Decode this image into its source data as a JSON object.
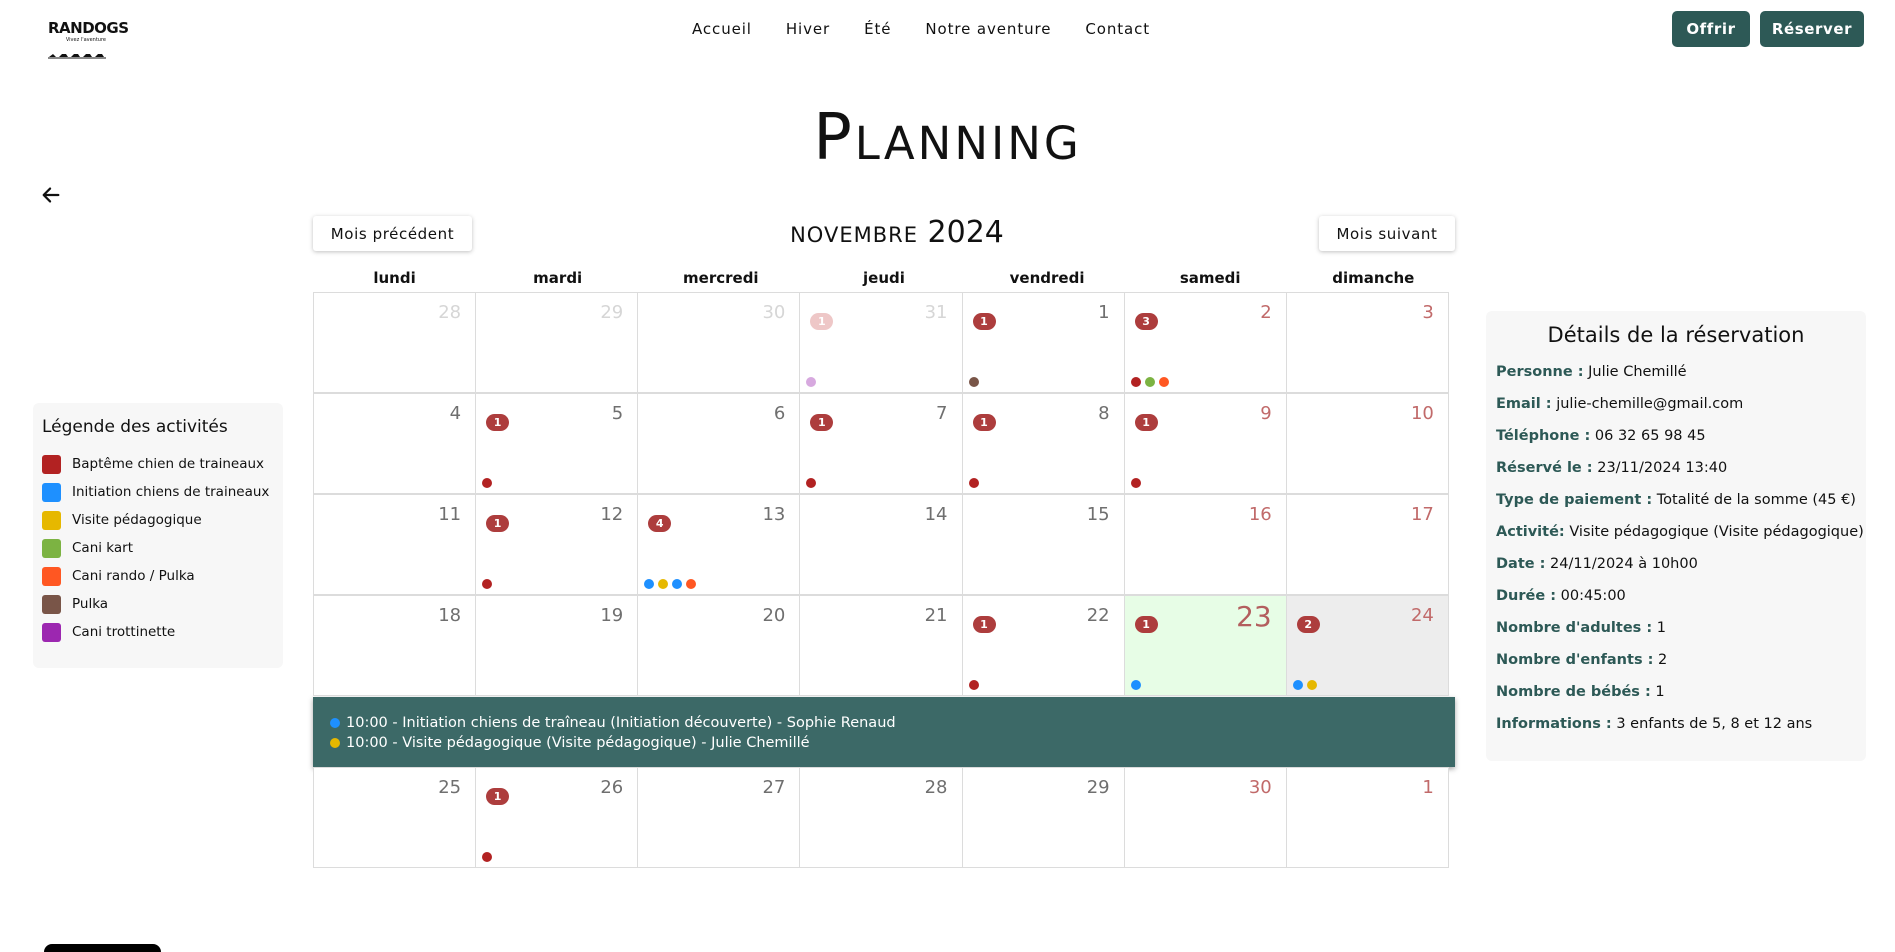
{
  "header": {
    "logo": {
      "title": "RANDOGS",
      "subtitle": "Vivez l'aventure"
    },
    "nav": [
      "Accueil",
      "Hiver",
      "Été",
      "Notre aventure",
      "Contact"
    ],
    "buttons": {
      "offrir": "Offrir",
      "reserver": "Réserver"
    },
    "accent_color": "#2d5956"
  },
  "page_title": "Planning",
  "legend": {
    "title": "Légende des activités",
    "items": [
      {
        "label": "Baptême chien de traineaux",
        "color": "#b22222"
      },
      {
        "label": "Initiation chiens de traineaux",
        "color": "#1e90ff"
      },
      {
        "label": "Visite pédagogique",
        "color": "#e6b800"
      },
      {
        "label": "Cani kart",
        "color": "#7cb342"
      },
      {
        "label": "Cani rando / Pulka",
        "color": "#ff5722"
      },
      {
        "label": "Pulka",
        "color": "#795548"
      },
      {
        "label": "Cani trottinette",
        "color": "#9c27b0"
      }
    ]
  },
  "calendar": {
    "prev_label": "Mois précédent",
    "next_label": "Mois suivant",
    "month": "novembre",
    "year": "2024",
    "weekdays": [
      "lundi",
      "mardi",
      "mercredi",
      "jeudi",
      "vendredi",
      "samedi",
      "dimanche"
    ],
    "weeks": [
      [
        {
          "day": "28",
          "other": true
        },
        {
          "day": "29",
          "other": true
        },
        {
          "day": "30",
          "other": true
        },
        {
          "day": "31",
          "other": true,
          "count": "1",
          "dots": [
            "#9c27b0"
          ]
        },
        {
          "day": "1",
          "count": "1",
          "dots": [
            "#795548"
          ]
        },
        {
          "day": "2",
          "weekend": true,
          "count": "3",
          "dots": [
            "#b22222",
            "#7cb342",
            "#ff5722"
          ]
        },
        {
          "day": "3",
          "weekend": true
        }
      ],
      [
        {
          "day": "4"
        },
        {
          "day": "5",
          "count": "1",
          "dots": [
            "#b22222"
          ]
        },
        {
          "day": "6"
        },
        {
          "day": "7",
          "count": "1",
          "dots": [
            "#b22222"
          ]
        },
        {
          "day": "8",
          "count": "1",
          "dots": [
            "#b22222"
          ]
        },
        {
          "day": "9",
          "weekend": true,
          "count": "1",
          "dots": [
            "#b22222"
          ]
        },
        {
          "day": "10",
          "weekend": true
        }
      ],
      [
        {
          "day": "11"
        },
        {
          "day": "12",
          "count": "1",
          "dots": [
            "#b22222"
          ]
        },
        {
          "day": "13",
          "count": "4",
          "dots": [
            "#1e90ff",
            "#e6b800",
            "#1e90ff",
            "#ff5722"
          ]
        },
        {
          "day": "14"
        },
        {
          "day": "15"
        },
        {
          "day": "16",
          "weekend": true
        },
        {
          "day": "17",
          "weekend": true
        }
      ],
      [
        {
          "day": "18"
        },
        {
          "day": "19"
        },
        {
          "day": "20"
        },
        {
          "day": "21"
        },
        {
          "day": "22",
          "count": "1",
          "dots": [
            "#b22222"
          ]
        },
        {
          "day": "23",
          "weekend": true,
          "today": true,
          "count": "1",
          "dots": [
            "#1e90ff"
          ]
        },
        {
          "day": "24",
          "weekend": true,
          "selected": true,
          "count": "2",
          "dots": [
            "#1e90ff",
            "#e6b800"
          ]
        }
      ],
      [
        {
          "day": "25"
        },
        {
          "day": "26",
          "count": "1",
          "dots": [
            "#b22222"
          ]
        },
        {
          "day": "27"
        },
        {
          "day": "28"
        },
        {
          "day": "29"
        },
        {
          "day": "30",
          "weekend": true
        },
        {
          "day": "1",
          "other": true,
          "weekend": true
        }
      ]
    ],
    "selected_day_events": [
      {
        "color": "#1e90ff",
        "text": "10:00 - Initiation chiens de traîneau (Initiation découverte) - Sophie Renaud"
      },
      {
        "color": "#e6b800",
        "text": "10:00 - Visite pédagogique (Visite pédagogique) - Julie Chemillé"
      }
    ]
  },
  "details": {
    "title": "Détails de la réservation",
    "rows": [
      {
        "key": "Personne :",
        "value": "Julie Chemillé"
      },
      {
        "key": "Email :",
        "value": "julie-chemille@gmail.com"
      },
      {
        "key": "Téléphone :",
        "value": "06 32 65 98 45"
      },
      {
        "key": "Réservé le :",
        "value": "23/11/2024 13:40"
      },
      {
        "key": "Type de paiement :",
        "value": "Totalité de la somme (45 €)"
      },
      {
        "key": "Activité:",
        "value": "Visite pédagogique (Visite pédagogique)"
      },
      {
        "key": "Date :",
        "value": "24/11/2024 à 10h00"
      },
      {
        "key": "Durée :",
        "value": "00:45:00"
      },
      {
        "key": "Nombre d'adultes :",
        "value": "1"
      },
      {
        "key": "Nombre d'enfants :",
        "value": "2"
      },
      {
        "key": "Nombre de bébés :",
        "value": "1"
      },
      {
        "key": "Informations :",
        "value": "3 enfants de 5, 8 et 12 ans"
      }
    ]
  }
}
